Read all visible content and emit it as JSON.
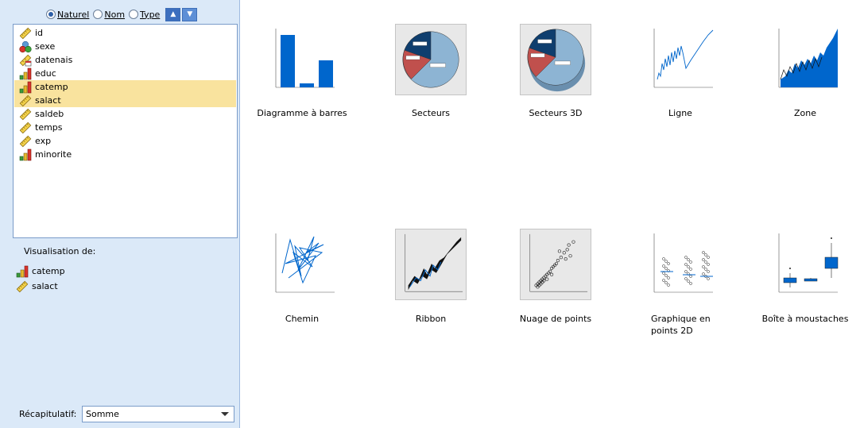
{
  "sort": {
    "options": [
      "Naturel",
      "Nom",
      "Type"
    ],
    "selected": "Naturel",
    "asc_icon": "sort-ascending-icon",
    "desc_icon": "sort-descending-icon"
  },
  "variables": [
    {
      "name": "id",
      "icon": "scale-ruler-icon",
      "selected": false
    },
    {
      "name": "sexe",
      "icon": "nominal-icon",
      "selected": false
    },
    {
      "name": "datenais",
      "icon": "date-scale-icon",
      "selected": false
    },
    {
      "name": "educ",
      "icon": "ordinal-icon",
      "selected": false
    },
    {
      "name": "catemp",
      "icon": "ordinal-icon",
      "selected": true
    },
    {
      "name": "salact",
      "icon": "scale-ruler-icon",
      "selected": true
    },
    {
      "name": "saldeb",
      "icon": "scale-ruler-icon",
      "selected": false
    },
    {
      "name": "temps",
      "icon": "scale-ruler-icon",
      "selected": false
    },
    {
      "name": "exp",
      "icon": "scale-ruler-icon",
      "selected": false
    },
    {
      "name": "minorite",
      "icon": "ordinal-icon",
      "selected": false
    }
  ],
  "visualisation": {
    "label": "Visualisation de:",
    "items": [
      {
        "name": "catemp",
        "icon": "ordinal-icon"
      },
      {
        "name": "salact",
        "icon": "scale-ruler-icon"
      }
    ]
  },
  "summary": {
    "label": "Récapitulatif:",
    "value": "Somme"
  },
  "gallery": [
    {
      "caption": "Diagramme à barres",
      "kind": "bar"
    },
    {
      "caption": "Secteurs",
      "kind": "pie"
    },
    {
      "caption": "Secteurs 3D",
      "kind": "pie3d"
    },
    {
      "caption": "Ligne",
      "kind": "line"
    },
    {
      "caption": "Zone",
      "kind": "area"
    },
    {
      "caption": "Chemin",
      "kind": "path"
    },
    {
      "caption": "Ribbon",
      "kind": "ribbon"
    },
    {
      "caption": "Nuage de points",
      "kind": "scatter"
    },
    {
      "caption": "Graphique en points 2D",
      "kind": "dot2d"
    },
    {
      "caption": "Boîte à moustaches",
      "kind": "boxplot"
    }
  ],
  "colors": {
    "accent": "#0066cc",
    "selection": "#f9e39e",
    "panel": "#dbe9f8",
    "pie_red": "#c0504d",
    "pie_light": "#8db4d3",
    "pie_dark": "#0f3e6e"
  }
}
